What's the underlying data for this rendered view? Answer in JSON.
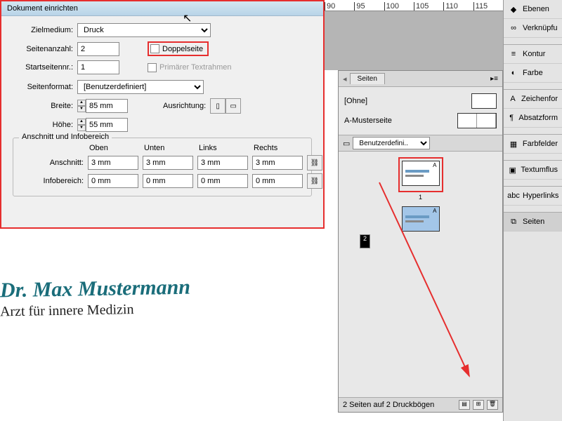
{
  "dialog": {
    "title": "Dokument einrichten",
    "zielmedium_label": "Zielmedium:",
    "zielmedium_value": "Druck",
    "seitenanzahl_label": "Seitenanzahl:",
    "seitenanzahl_value": "2",
    "doppelseite_label": "Doppelseite",
    "startseite_label": "Startseitennr.:",
    "startseite_value": "1",
    "primaer_label": "Primärer Textrahmen",
    "seitenformat_label": "Seitenformat:",
    "seitenformat_value": "[Benutzerdefiniert]",
    "breite_label": "Breite:",
    "breite_value": "85 mm",
    "hoehe_label": "Höhe:",
    "hoehe_value": "55 mm",
    "ausrichtung_label": "Ausrichtung:",
    "anschnitt_title": "Anschnitt und Infobereich",
    "col_oben": "Oben",
    "col_unten": "Unten",
    "col_links": "Links",
    "col_rechts": "Rechts",
    "anschnitt_label": "Anschnitt:",
    "anschnitt_values": [
      "3 mm",
      "3 mm",
      "3 mm",
      "3 mm"
    ],
    "infobereich_label": "Infobereich:",
    "infobereich_values": [
      "0 mm",
      "0 mm",
      "0 mm",
      "0 mm"
    ]
  },
  "ruler": [
    "90",
    "95",
    "100",
    "105",
    "110",
    "115"
  ],
  "pages_panel": {
    "tab": "Seiten",
    "master_none": "[Ohne]",
    "master_a": "A-Musterseite",
    "size_select": "Benutzerdefini..",
    "page1_letter": "A",
    "page1_num": "1",
    "page2_letter": "A",
    "page2_num": "2",
    "footer": "2 Seiten auf 2 Druckbögen"
  },
  "rtool": {
    "ebenen": "Ebenen",
    "verknuepf": "Verknüpfu",
    "kontur": "Kontur",
    "farbe": "Farbe",
    "zeichenform": "Zeichenfor",
    "absatzform": "Absatzform",
    "farbfelder": "Farbfelder",
    "textumflus": "Textumflus",
    "hyperlinks": "Hyperlinks",
    "seiten": "Seiten"
  },
  "document": {
    "name": "Dr. Max Mustermann",
    "subtitle": "Arzt für innere Medizin"
  }
}
